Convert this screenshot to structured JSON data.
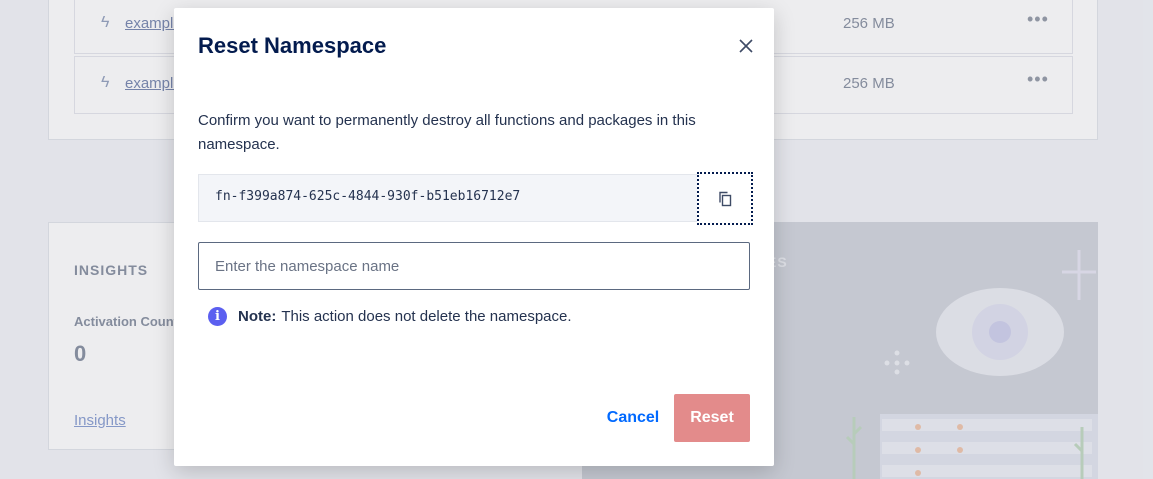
{
  "background": {
    "functions": [
      {
        "name": "example",
        "memory": "256 MB"
      },
      {
        "name": "example",
        "memory": "256 MB"
      }
    ],
    "more_label": "•••",
    "insights": {
      "title": "INSIGHTS",
      "activation_label": "Activation Count",
      "activation_value": "0",
      "link": "Insights"
    },
    "illustration_heading": "ES"
  },
  "modal": {
    "title": "Reset Namespace",
    "body": "Confirm you want to permanently destroy all functions and packages in this namespace.",
    "namespace_id": "fn-f399a874-625c-4844-930f-b51eb16712e7",
    "input_placeholder": "Enter the namespace name",
    "input_value": "",
    "note_label": "Note:",
    "note_text": "This action does not delete the namespace.",
    "cancel_label": "Cancel",
    "reset_label": "Reset"
  },
  "colors": {
    "title": "#031b4e",
    "link": "#0069ff",
    "reset_disabled": "#e38b8b",
    "info": "#5b5ff0"
  },
  "icons": [
    "close-icon",
    "copy-icon",
    "info-icon",
    "function-icon",
    "more-icon",
    "eye-illustration"
  ]
}
